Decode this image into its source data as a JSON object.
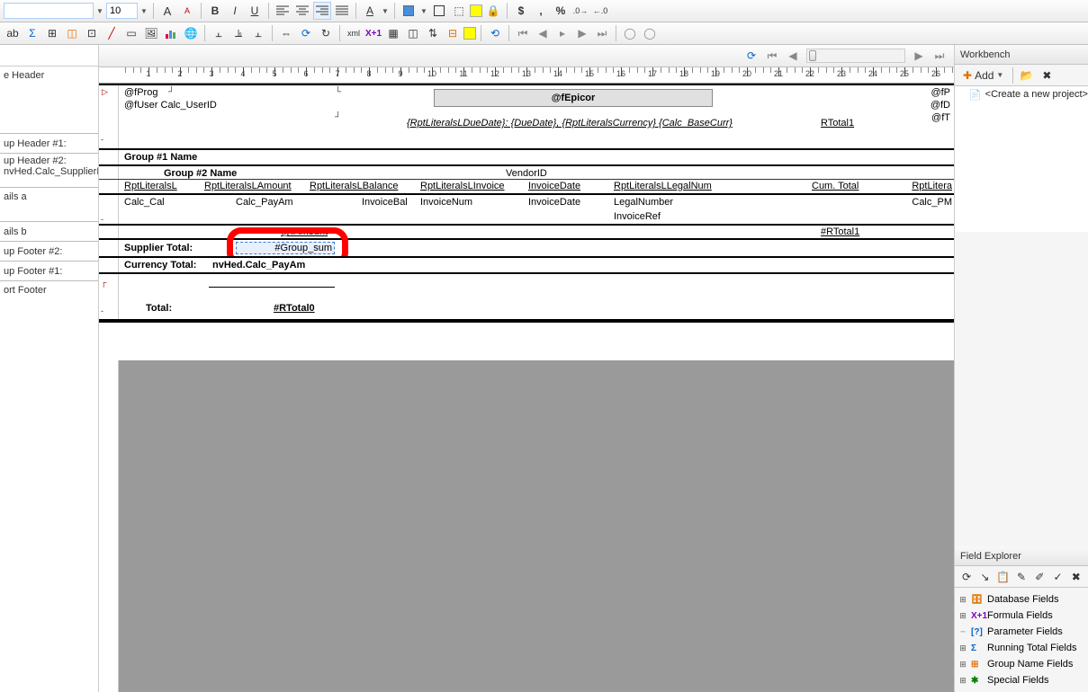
{
  "toolbar1": {
    "font_name": "",
    "font_size": "10"
  },
  "toolbar_icons1": [
    "plus-font",
    "minus-font",
    "bold",
    "italic",
    "underline",
    "align-left",
    "align-center",
    "align-right",
    "align-justify",
    "font-color",
    "highlight",
    "border-outer",
    "drop-shadow",
    "toggle-grid",
    "lock",
    "currency",
    "comma",
    "percent",
    "increase-decimal",
    "decrease-decimal"
  ],
  "toolbar_icons2": [
    "pivot",
    "sigma",
    "group",
    "insert-section",
    "insert-subreport",
    "line",
    "box",
    "chart",
    "map",
    "globe",
    "align-l",
    "align-c",
    "align-r",
    "h-dist",
    "v-dist",
    "refresh",
    "rotate",
    "xml",
    "formula-x1",
    "insert-field",
    "insert-image",
    "object",
    "highlight-field",
    "sync",
    "sep",
    "first",
    "prev",
    "current",
    "next",
    "last",
    "nav-back",
    "nav-fwd"
  ],
  "sections": {
    "page_header": "e Header",
    "group_header1": "up Header #1:",
    "group_header2": "up Header #2:",
    "group_header2_sub": "nvHed.Calc_SupplierNa",
    "details_a": "ails a",
    "details_b": "ails b",
    "group_footer2": "up Footer #2:",
    "group_footer1": "up Footer #1:",
    "report_footer": "ort Footer"
  },
  "canvas": {
    "ph": {
      "fProg": "@fProg",
      "fUser": "@fUser Calc_UserID",
      "epicor": "@fEpicor",
      "fP": "@fP",
      "fD": "@fD",
      "fT": "@fT",
      "rptLiterals": "{RptLiteralsLDueDate}: {DueDate}, {RptLiteralsCurrency} {Calc_BaseCurr}",
      "rtotal1": "RTotal1"
    },
    "gh1": "Group #1 Name",
    "gh2": {
      "name": "Group #2 Name",
      "vendor": "VendorID"
    },
    "gh2b": {
      "c1": "RptLiteralsL",
      "c2": "RptLiteralsLAmount",
      "c3": "RptLiteralsLBalance",
      "c4": "RptLiteralsLInvoice",
      "c5": "InvoiceDate",
      "c6": "RptLiteralsLLegalNum",
      "c7": "Cum. Total",
      "c8": "RptLitera"
    },
    "da": {
      "c1": "Calc_Cal",
      "c2": "Calc_PayAm",
      "c3": "InvoiceBal",
      "c4": "InvoiceNum",
      "c5": "InvoiceDate",
      "c6": "LegalNumber",
      "c7": "InvoiceRef",
      "c8": "Calc_PM"
    },
    "db": {
      "amount": "@fAmount",
      "rtotal": "#RTotal1"
    },
    "gf2": {
      "label": "Supplier Total:",
      "val": "#Group_sum"
    },
    "gf1": {
      "label": "Currency Total:",
      "val": "nvHed.Calc_PayAm"
    },
    "rf": {
      "label": "Total:",
      "val": "#RTotal0"
    }
  },
  "workbench": {
    "title": "Workbench",
    "add": "Add",
    "create_project": "<Create a new project>"
  },
  "field_explorer": {
    "title": "Field Explorer",
    "nodes": [
      {
        "icon": "db",
        "label": "Database Fields",
        "exp": "+"
      },
      {
        "icon": "fx",
        "label": "Formula Fields",
        "exp": "+"
      },
      {
        "icon": "pm",
        "label": "Parameter Fields",
        "exp": ""
      },
      {
        "icon": "rt",
        "label": "Running Total Fields",
        "exp": "+"
      },
      {
        "icon": "gn",
        "label": "Group Name Fields",
        "exp": "+"
      },
      {
        "icon": "sp",
        "label": "Special Fields",
        "exp": "+"
      }
    ]
  },
  "ruler_max": 29
}
